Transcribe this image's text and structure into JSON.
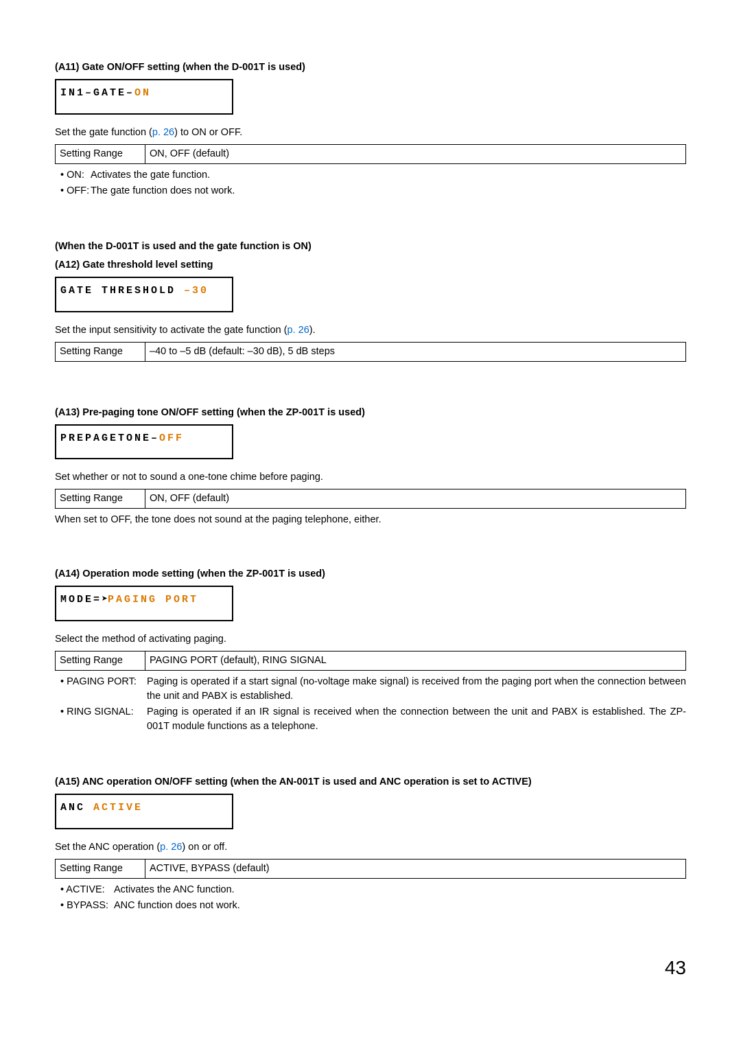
{
  "a11": {
    "title": "(A11) Gate ON/OFF setting (when the D-001T is used)",
    "lcd_black": "IN1–GATE–",
    "lcd_orange": "ON",
    "desc_pre": "Set the gate function (",
    "desc_link": "p. 26",
    "desc_post": ") to ON or OFF.",
    "range_label": "Setting Range",
    "range_value": "ON, OFF (default)",
    "on_key": "• ON:",
    "on_val": "Activates the gate function.",
    "off_key": "• OFF:",
    "off_val": "The gate function does not work."
  },
  "a12": {
    "pretitle": "(When the D-001T is used and the gate function is ON)",
    "title": "(A12) Gate threshold level setting",
    "lcd_black": "GATE THRESHOLD ",
    "lcd_orange": "–30",
    "desc_pre": "Set the input sensitivity to activate the gate function (",
    "desc_link": "p. 26",
    "desc_post": ").",
    "range_label": "Setting Range",
    "range_value": "–40 to –5 dB (default: –30 dB), 5 dB steps"
  },
  "a13": {
    "title": "(A13) Pre-paging tone ON/OFF setting (when the ZP-001T is used)",
    "lcd_black": "PREPAGETONE–",
    "lcd_orange": "OFF",
    "desc": "Set whether or not to sound a one-tone chime before paging.",
    "range_label": "Setting Range",
    "range_value": "ON, OFF (default)",
    "note": "When set to OFF, the tone does not sound at the paging telephone, either."
  },
  "a14": {
    "title": "(A14) Operation mode setting (when the ZP-001T is used)",
    "lcd_black": "MODE=",
    "lcd_arrow": "➤",
    "lcd_orange": "PAGING PORT",
    "desc": "Select the method of activating paging.",
    "range_label": "Setting Range",
    "range_value": "PAGING PORT (default), RING SIGNAL",
    "pp_key": "• PAGING PORT:",
    "pp_val": "Paging is operated if a start signal (no-voltage make signal) is received from the paging port when the connection between the unit and PABX is established.",
    "rs_key": "• RING SIGNAL:",
    "rs_val": "Paging is operated if an IR signal is received when the connection between the unit and PABX is established. The ZP-001T module functions as a telephone."
  },
  "a15": {
    "title": "(A15) ANC operation ON/OFF setting (when the AN-001T is used and ANC operation is set to ACTIVE)",
    "lcd_black": "ANC ",
    "lcd_orange": "ACTIVE",
    "desc_pre": "Set the ANC operation (",
    "desc_link": "p. 26",
    "desc_post": ") on or off.",
    "range_label": "Setting Range",
    "range_value": "ACTIVE, BYPASS (default)",
    "act_key": "• ACTIVE:",
    "act_val": "Activates the ANC function.",
    "byp_key": "• BYPASS:",
    "byp_val": "ANC function does not work."
  },
  "page_number": "43"
}
